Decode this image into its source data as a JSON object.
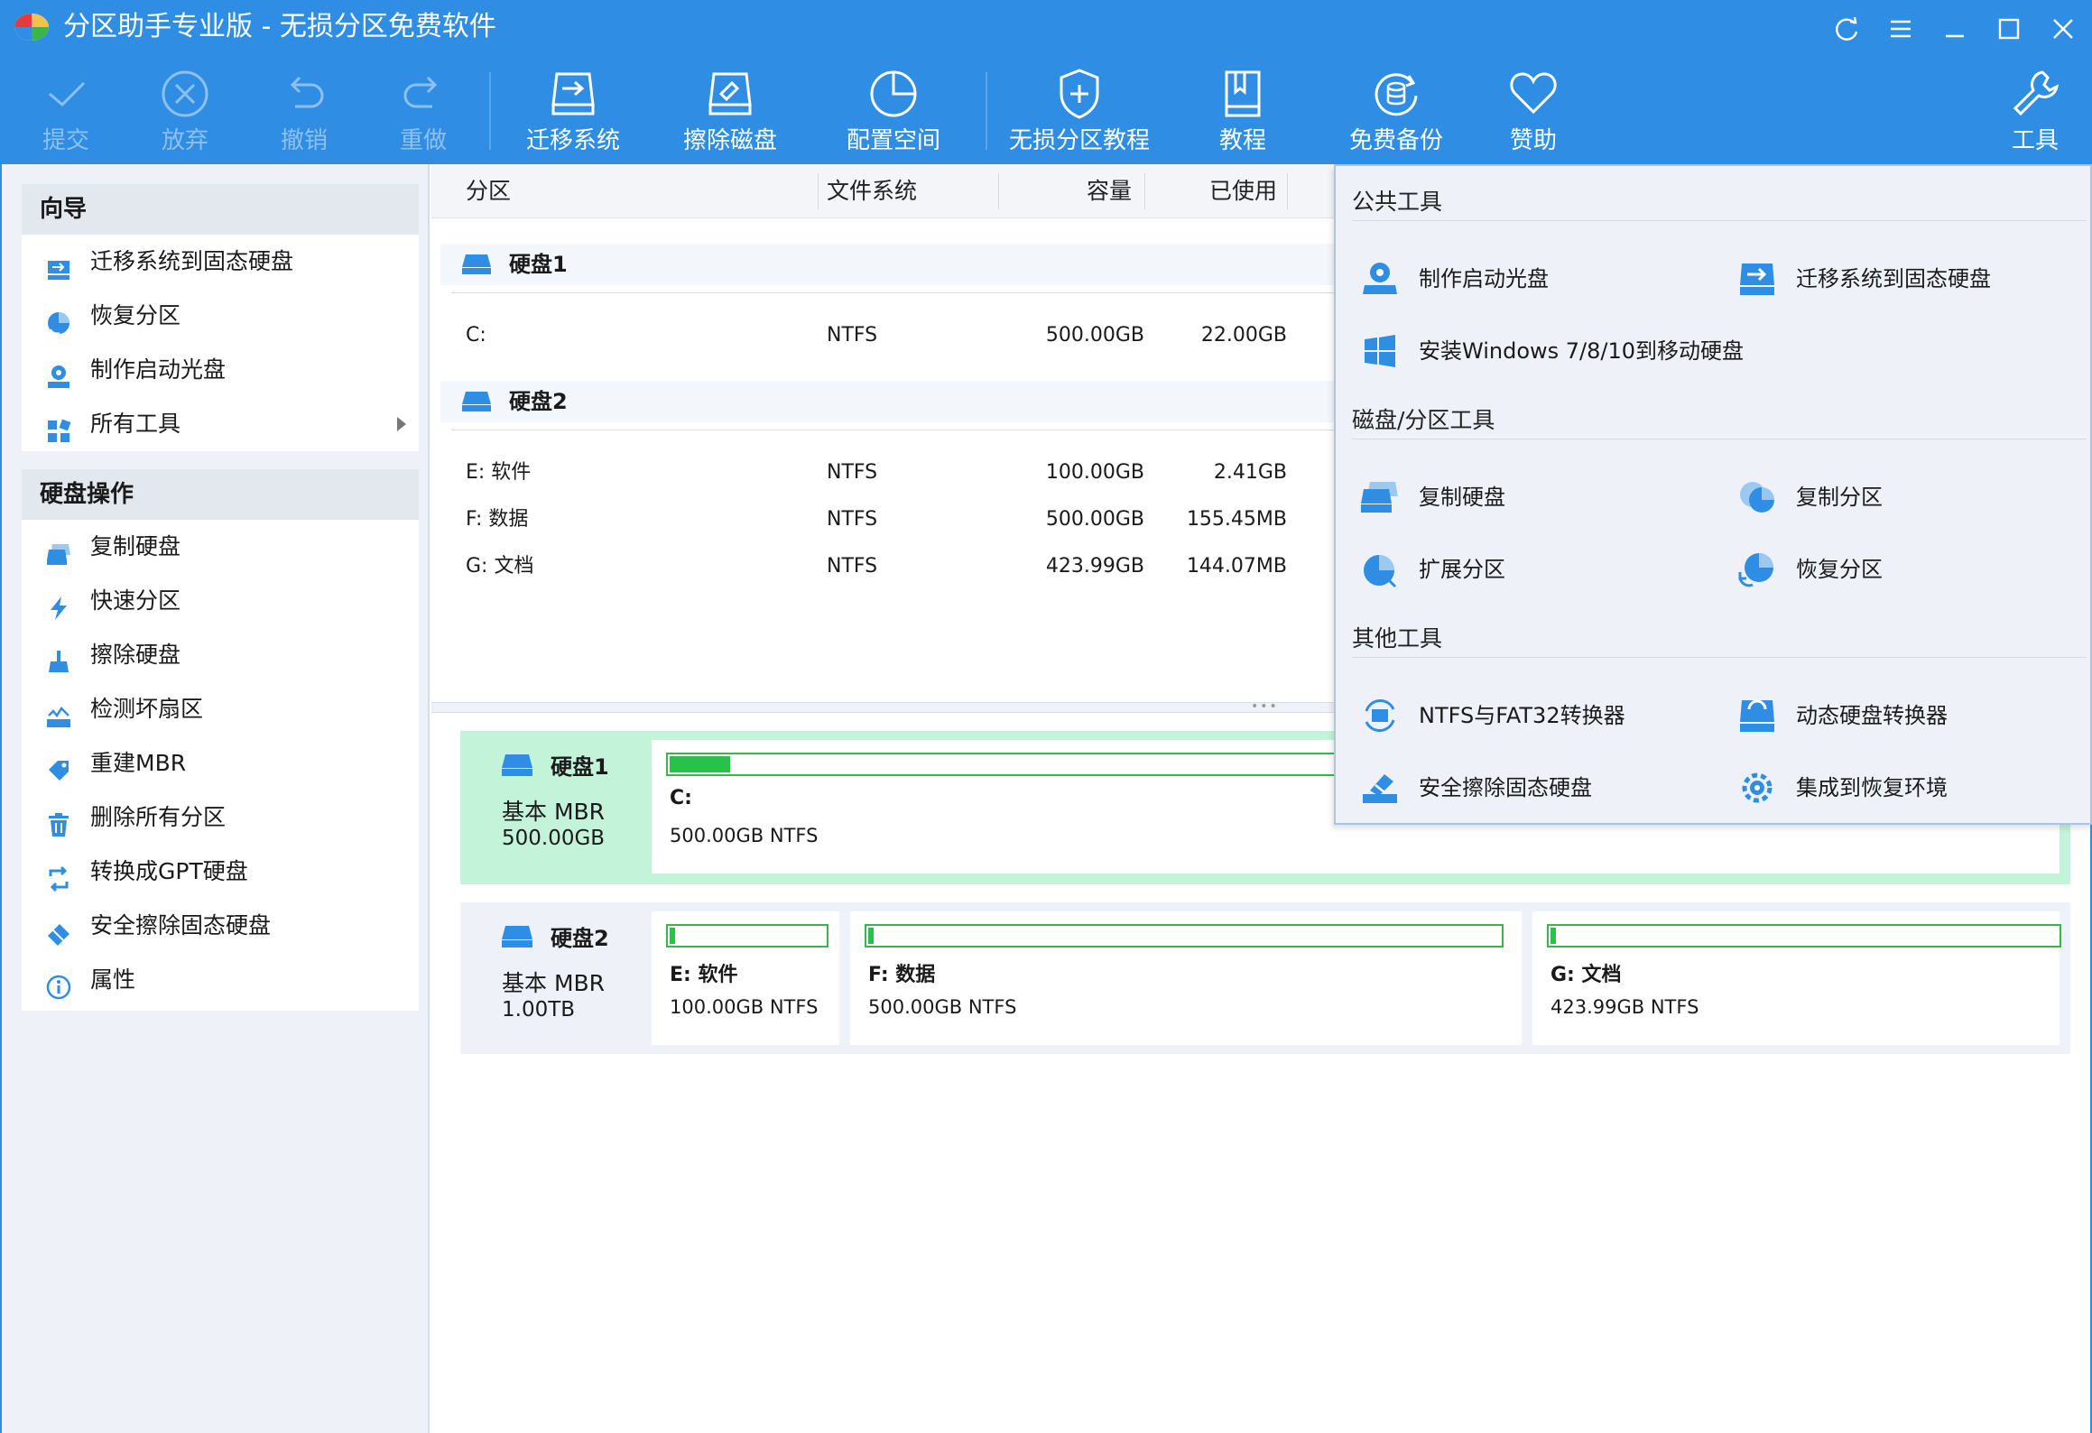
{
  "window": {
    "title": "分区助手专业版 - 无损分区免费软件"
  },
  "toolbar": {
    "commit": "提交",
    "discard": "放弃",
    "undo": "撤销",
    "redo": "重做",
    "migrate": "迁移系统",
    "wipe": "擦除磁盘",
    "allocate": "配置空间",
    "tutorial_lossless": "无损分区教程",
    "tutorial": "教程",
    "backup": "免费备份",
    "sponsor": "赞助",
    "tools": "工具"
  },
  "sidebar": {
    "wizard": {
      "title": "向导",
      "items": [
        "迁移系统到固态硬盘",
        "恢复分区",
        "制作启动光盘",
        "所有工具"
      ]
    },
    "disk_ops": {
      "title": "硬盘操作",
      "items": [
        "复制硬盘",
        "快速分区",
        "擦除硬盘",
        "检测坏扇区",
        "重建MBR",
        "删除所有分区",
        "转换成GPT硬盘",
        "安全擦除固态硬盘",
        "属性"
      ]
    }
  },
  "table": {
    "headers": {
      "partition": "分区",
      "fs": "文件系统",
      "capacity": "容量",
      "used": "已使用"
    },
    "disk1": {
      "name": "硬盘1",
      "rows": [
        {
          "part": "C:",
          "fs": "NTFS",
          "cap": "500.00GB",
          "used": "22.00GB"
        }
      ]
    },
    "disk2": {
      "name": "硬盘2",
      "rows": [
        {
          "part": "E: 软件",
          "fs": "NTFS",
          "cap": "100.00GB",
          "used": "2.41GB"
        },
        {
          "part": "F: 数据",
          "fs": "NTFS",
          "cap": "500.00GB",
          "used": "155.45MB"
        },
        {
          "part": "G: 文档",
          "fs": "NTFS",
          "cap": "423.99GB",
          "used": "144.07MB"
        }
      ]
    }
  },
  "disk_map": {
    "disk1": {
      "name": "硬盘1",
      "type": "基本 MBR",
      "size": "500.00GB",
      "partitions": [
        {
          "name": "C:",
          "desc": "500.00GB NTFS",
          "used_fraction": 0.044
        }
      ]
    },
    "disk2": {
      "name": "硬盘2",
      "type": "基本 MBR",
      "size": "1.00TB",
      "partitions": [
        {
          "name": "E: 软件",
          "desc": "100.00GB NTFS",
          "used_fraction": 0.024
        },
        {
          "name": "F: 数据",
          "desc": "500.00GB NTFS",
          "used_fraction": 0.0003
        },
        {
          "name": "G: 文档",
          "desc": "423.99GB NTFS",
          "used_fraction": 0.0003
        }
      ]
    }
  },
  "tools_menu": {
    "public": {
      "title": "公共工具",
      "items": [
        "制作启动光盘",
        "迁移系统到固态硬盘",
        "安装Windows 7/8/10到移动硬盘"
      ]
    },
    "disk_part": {
      "title": "磁盘/分区工具",
      "items": [
        "复制硬盘",
        "复制分区",
        "扩展分区",
        "恢复分区"
      ]
    },
    "other": {
      "title": "其他工具",
      "items": [
        "NTFS与FAT32转换器",
        "动态硬盘转换器",
        "安全擦除固态硬盘",
        "集成到恢复环境"
      ]
    }
  },
  "colors": {
    "accent": "#2f8ee3",
    "used_bar": "#28c24a",
    "selected_disk": "#c3f4d9"
  }
}
